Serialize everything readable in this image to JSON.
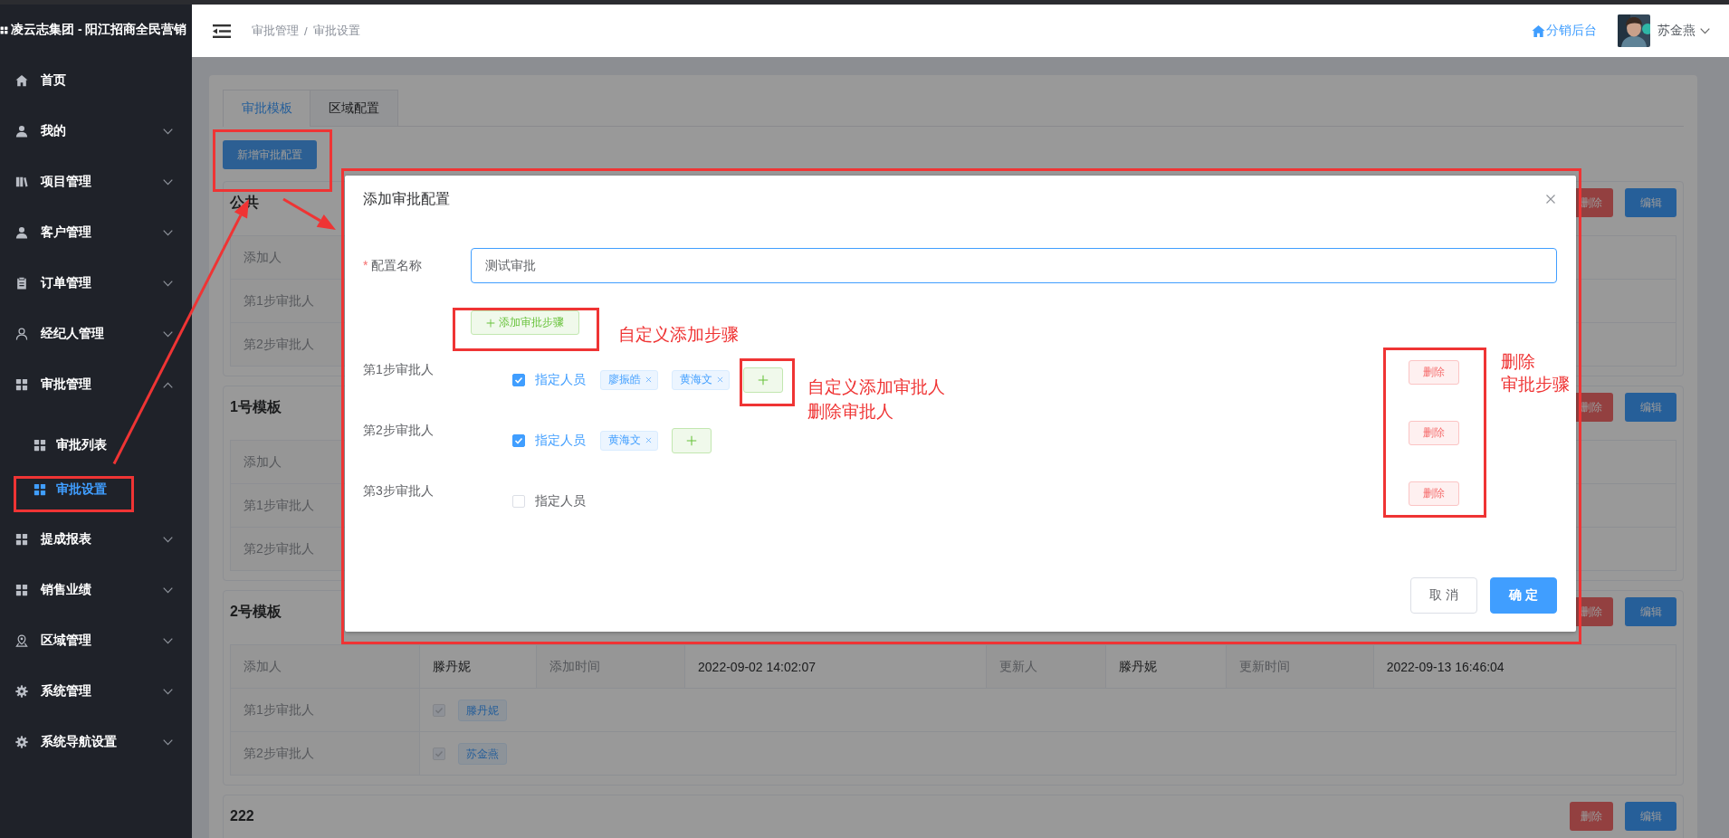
{
  "sidebar": {
    "title": "凌云志集团 - 阳江招商全民营销",
    "items": [
      {
        "label": "首页",
        "kind": "link"
      },
      {
        "label": "我的",
        "kind": "group",
        "expanded": false
      },
      {
        "label": "项目管理",
        "kind": "group",
        "expanded": false
      },
      {
        "label": "客户管理",
        "kind": "group",
        "expanded": false
      },
      {
        "label": "订单管理",
        "kind": "group",
        "expanded": false
      },
      {
        "label": "经纪人管理",
        "kind": "group",
        "expanded": false
      },
      {
        "label": "审批管理",
        "kind": "group",
        "expanded": true,
        "children": [
          {
            "label": "审批列表",
            "selected": false
          },
          {
            "label": "审批设置",
            "selected": true
          }
        ]
      },
      {
        "label": "提成报表",
        "kind": "group",
        "expanded": false
      },
      {
        "label": "销售业绩",
        "kind": "group",
        "expanded": false
      },
      {
        "label": "区域管理",
        "kind": "group",
        "expanded": false
      },
      {
        "label": "系统管理",
        "kind": "group",
        "expanded": false
      },
      {
        "label": "系统导航设置",
        "kind": "group",
        "expanded": false
      }
    ]
  },
  "header": {
    "breadcrumb": [
      "审批管理",
      "审批设置"
    ],
    "separator": "/",
    "portal_link": "分销后台",
    "user_name": "苏金燕"
  },
  "page": {
    "tabs": [
      {
        "label": "审批模板",
        "selected": true
      },
      {
        "label": "区域配置",
        "selected": false
      }
    ],
    "add_button": "新增审批配置",
    "templates": [
      {
        "title": "公共",
        "delete_button": "删除",
        "edit_button": "编辑",
        "rows": [
          {
            "label": "添加人"
          },
          {
            "label": "第1步审批人"
          },
          {
            "label": "第2步审批人"
          }
        ]
      },
      {
        "title": "1号模板",
        "delete_button": "删除",
        "edit_button": "编辑",
        "rows": [
          {
            "label": "添加人"
          },
          {
            "label": "第1步审批人"
          },
          {
            "label": "第2步审批人"
          }
        ]
      },
      {
        "title": "2号模板",
        "delete_button": "删除",
        "edit_button": "编辑",
        "rows": [
          {
            "kind": "info",
            "label": "添加人",
            "value": "滕丹妮",
            "fields": [
              {
                "label": "添加时间",
                "value": "2022-09-02 14:02:07"
              },
              {
                "label": "更新人",
                "value": "滕丹妮"
              },
              {
                "label": "更新时间",
                "value": "2022-09-13 16:46:04"
              }
            ]
          },
          {
            "kind": "approvers",
            "label": "第1步审批人",
            "checked": true,
            "tags": [
              "滕丹妮"
            ]
          },
          {
            "kind": "approvers",
            "label": "第2步审批人",
            "checked": true,
            "tags": [
              "苏金燕"
            ]
          }
        ]
      },
      {
        "title": "222",
        "delete_button": "删除",
        "edit_button": "编辑"
      }
    ]
  },
  "modal": {
    "title": "添加审批配置",
    "name_field": {
      "required_mark": "*",
      "label": "配置名称",
      "value": "测试审批"
    },
    "add_step_button": "添加审批步骤",
    "steps": [
      {
        "label": "第1步审批人",
        "checked": true,
        "option": "指定人员",
        "approvers": [
          "廖振皓",
          "黄海文"
        ],
        "delete_button": "删除"
      },
      {
        "label": "第2步审批人",
        "checked": true,
        "option": "指定人员",
        "approvers": [
          "黄海文"
        ],
        "delete_button": "删除"
      },
      {
        "label": "第3步审批人",
        "checked": false,
        "option": "指定人员",
        "delete_button": "删除"
      }
    ],
    "cancel_button": "取 消",
    "confirm_button": "确 定"
  },
  "annotations": [
    {
      "lines": [
        "自定义添加步骤"
      ]
    },
    {
      "lines": [
        "自定义添加审批人",
        "删除审批人"
      ]
    },
    {
      "lines": [
        "删除",
        "审批步骤"
      ]
    }
  ]
}
